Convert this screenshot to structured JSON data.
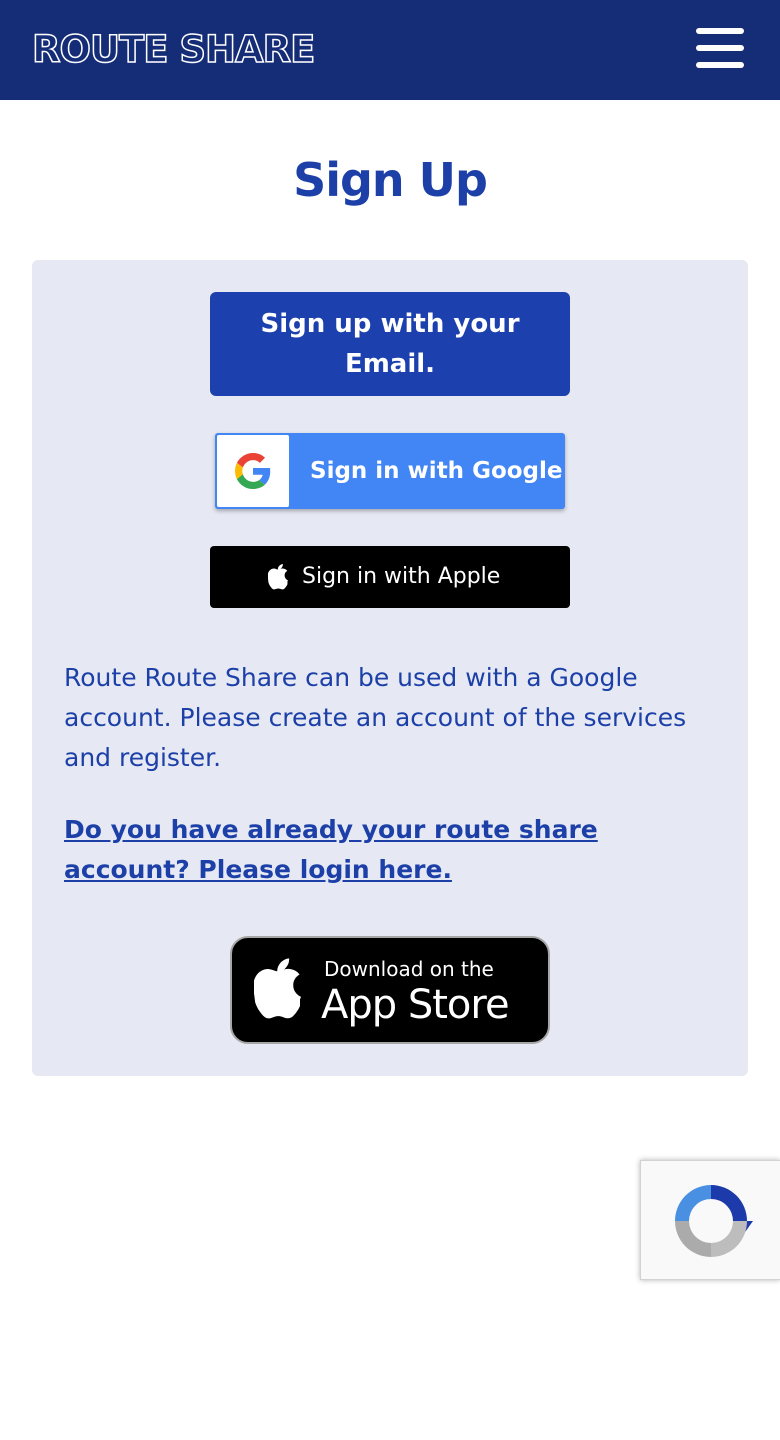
{
  "header": {
    "logo_text": "ROUTE SHARE",
    "menu_icon": "hamburger-menu-icon",
    "background": "#152d77"
  },
  "main": {
    "title": "Sign Up",
    "email_button_label": "Sign up with your Email.",
    "google_button_label": "Sign in with Google",
    "apple_button_label": "Sign in with Apple",
    "info_text": "Route Route Share can be used with a Google account. Please create an account of the services and register.",
    "login_link_text": "Do you have already your route share account? Please login here.",
    "app_store": {
      "small_text": "Download on the",
      "big_text": "App Store"
    }
  },
  "recaptcha": {
    "icon": "recaptcha-icon"
  },
  "colors": {
    "accent": "#1c40a8",
    "panel_bg": "#e6e9f3",
    "google_blue": "#4285f4"
  }
}
